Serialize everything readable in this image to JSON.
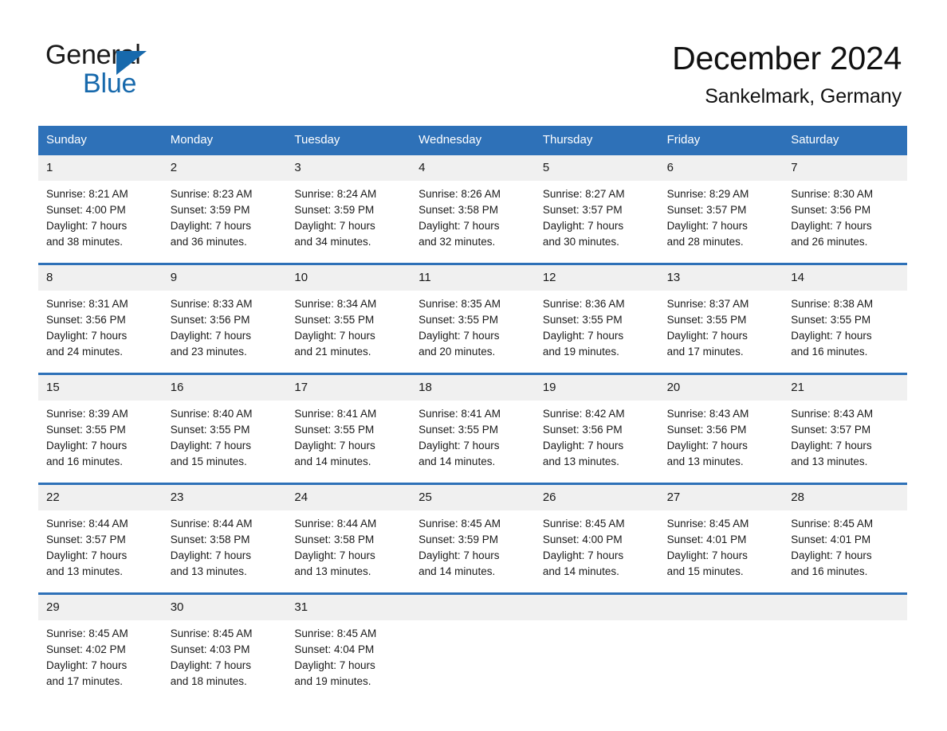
{
  "brand": {
    "name_part1": "General",
    "name_part2": "Blue"
  },
  "header": {
    "title": "December 2024",
    "subtitle": "Sankelmark, Germany"
  },
  "colors": {
    "header_blue": "#2e71b8",
    "brand_blue": "#1769ac",
    "daynum_background": "#f0f0f0",
    "text": "#1a1a1a"
  },
  "weekdays": [
    "Sunday",
    "Monday",
    "Tuesday",
    "Wednesday",
    "Thursday",
    "Friday",
    "Saturday"
  ],
  "labels": {
    "sunrise_prefix": "Sunrise:",
    "sunset_prefix": "Sunset:",
    "daylight_prefix": "Daylight:"
  },
  "weeks": [
    [
      {
        "day": "1",
        "sunrise": "Sunrise: 8:21 AM",
        "sunset": "Sunset: 4:00 PM",
        "daylight_line1": "Daylight: 7 hours",
        "daylight_line2": "and 38 minutes."
      },
      {
        "day": "2",
        "sunrise": "Sunrise: 8:23 AM",
        "sunset": "Sunset: 3:59 PM",
        "daylight_line1": "Daylight: 7 hours",
        "daylight_line2": "and 36 minutes."
      },
      {
        "day": "3",
        "sunrise": "Sunrise: 8:24 AM",
        "sunset": "Sunset: 3:59 PM",
        "daylight_line1": "Daylight: 7 hours",
        "daylight_line2": "and 34 minutes."
      },
      {
        "day": "4",
        "sunrise": "Sunrise: 8:26 AM",
        "sunset": "Sunset: 3:58 PM",
        "daylight_line1": "Daylight: 7 hours",
        "daylight_line2": "and 32 minutes."
      },
      {
        "day": "5",
        "sunrise": "Sunrise: 8:27 AM",
        "sunset": "Sunset: 3:57 PM",
        "daylight_line1": "Daylight: 7 hours",
        "daylight_line2": "and 30 minutes."
      },
      {
        "day": "6",
        "sunrise": "Sunrise: 8:29 AM",
        "sunset": "Sunset: 3:57 PM",
        "daylight_line1": "Daylight: 7 hours",
        "daylight_line2": "and 28 minutes."
      },
      {
        "day": "7",
        "sunrise": "Sunrise: 8:30 AM",
        "sunset": "Sunset: 3:56 PM",
        "daylight_line1": "Daylight: 7 hours",
        "daylight_line2": "and 26 minutes."
      }
    ],
    [
      {
        "day": "8",
        "sunrise": "Sunrise: 8:31 AM",
        "sunset": "Sunset: 3:56 PM",
        "daylight_line1": "Daylight: 7 hours",
        "daylight_line2": "and 24 minutes."
      },
      {
        "day": "9",
        "sunrise": "Sunrise: 8:33 AM",
        "sunset": "Sunset: 3:56 PM",
        "daylight_line1": "Daylight: 7 hours",
        "daylight_line2": "and 23 minutes."
      },
      {
        "day": "10",
        "sunrise": "Sunrise: 8:34 AM",
        "sunset": "Sunset: 3:55 PM",
        "daylight_line1": "Daylight: 7 hours",
        "daylight_line2": "and 21 minutes."
      },
      {
        "day": "11",
        "sunrise": "Sunrise: 8:35 AM",
        "sunset": "Sunset: 3:55 PM",
        "daylight_line1": "Daylight: 7 hours",
        "daylight_line2": "and 20 minutes."
      },
      {
        "day": "12",
        "sunrise": "Sunrise: 8:36 AM",
        "sunset": "Sunset: 3:55 PM",
        "daylight_line1": "Daylight: 7 hours",
        "daylight_line2": "and 19 minutes."
      },
      {
        "day": "13",
        "sunrise": "Sunrise: 8:37 AM",
        "sunset": "Sunset: 3:55 PM",
        "daylight_line1": "Daylight: 7 hours",
        "daylight_line2": "and 17 minutes."
      },
      {
        "day": "14",
        "sunrise": "Sunrise: 8:38 AM",
        "sunset": "Sunset: 3:55 PM",
        "daylight_line1": "Daylight: 7 hours",
        "daylight_line2": "and 16 minutes."
      }
    ],
    [
      {
        "day": "15",
        "sunrise": "Sunrise: 8:39 AM",
        "sunset": "Sunset: 3:55 PM",
        "daylight_line1": "Daylight: 7 hours",
        "daylight_line2": "and 16 minutes."
      },
      {
        "day": "16",
        "sunrise": "Sunrise: 8:40 AM",
        "sunset": "Sunset: 3:55 PM",
        "daylight_line1": "Daylight: 7 hours",
        "daylight_line2": "and 15 minutes."
      },
      {
        "day": "17",
        "sunrise": "Sunrise: 8:41 AM",
        "sunset": "Sunset: 3:55 PM",
        "daylight_line1": "Daylight: 7 hours",
        "daylight_line2": "and 14 minutes."
      },
      {
        "day": "18",
        "sunrise": "Sunrise: 8:41 AM",
        "sunset": "Sunset: 3:55 PM",
        "daylight_line1": "Daylight: 7 hours",
        "daylight_line2": "and 14 minutes."
      },
      {
        "day": "19",
        "sunrise": "Sunrise: 8:42 AM",
        "sunset": "Sunset: 3:56 PM",
        "daylight_line1": "Daylight: 7 hours",
        "daylight_line2": "and 13 minutes."
      },
      {
        "day": "20",
        "sunrise": "Sunrise: 8:43 AM",
        "sunset": "Sunset: 3:56 PM",
        "daylight_line1": "Daylight: 7 hours",
        "daylight_line2": "and 13 minutes."
      },
      {
        "day": "21",
        "sunrise": "Sunrise: 8:43 AM",
        "sunset": "Sunset: 3:57 PM",
        "daylight_line1": "Daylight: 7 hours",
        "daylight_line2": "and 13 minutes."
      }
    ],
    [
      {
        "day": "22",
        "sunrise": "Sunrise: 8:44 AM",
        "sunset": "Sunset: 3:57 PM",
        "daylight_line1": "Daylight: 7 hours",
        "daylight_line2": "and 13 minutes."
      },
      {
        "day": "23",
        "sunrise": "Sunrise: 8:44 AM",
        "sunset": "Sunset: 3:58 PM",
        "daylight_line1": "Daylight: 7 hours",
        "daylight_line2": "and 13 minutes."
      },
      {
        "day": "24",
        "sunrise": "Sunrise: 8:44 AM",
        "sunset": "Sunset: 3:58 PM",
        "daylight_line1": "Daylight: 7 hours",
        "daylight_line2": "and 13 minutes."
      },
      {
        "day": "25",
        "sunrise": "Sunrise: 8:45 AM",
        "sunset": "Sunset: 3:59 PM",
        "daylight_line1": "Daylight: 7 hours",
        "daylight_line2": "and 14 minutes."
      },
      {
        "day": "26",
        "sunrise": "Sunrise: 8:45 AM",
        "sunset": "Sunset: 4:00 PM",
        "daylight_line1": "Daylight: 7 hours",
        "daylight_line2": "and 14 minutes."
      },
      {
        "day": "27",
        "sunrise": "Sunrise: 8:45 AM",
        "sunset": "Sunset: 4:01 PM",
        "daylight_line1": "Daylight: 7 hours",
        "daylight_line2": "and 15 minutes."
      },
      {
        "day": "28",
        "sunrise": "Sunrise: 8:45 AM",
        "sunset": "Sunset: 4:01 PM",
        "daylight_line1": "Daylight: 7 hours",
        "daylight_line2": "and 16 minutes."
      }
    ],
    [
      {
        "day": "29",
        "sunrise": "Sunrise: 8:45 AM",
        "sunset": "Sunset: 4:02 PM",
        "daylight_line1": "Daylight: 7 hours",
        "daylight_line2": "and 17 minutes."
      },
      {
        "day": "30",
        "sunrise": "Sunrise: 8:45 AM",
        "sunset": "Sunset: 4:03 PM",
        "daylight_line1": "Daylight: 7 hours",
        "daylight_line2": "and 18 minutes."
      },
      {
        "day": "31",
        "sunrise": "Sunrise: 8:45 AM",
        "sunset": "Sunset: 4:04 PM",
        "daylight_line1": "Daylight: 7 hours",
        "daylight_line2": "and 19 minutes."
      },
      {
        "day": "",
        "sunrise": "",
        "sunset": "",
        "daylight_line1": "",
        "daylight_line2": ""
      },
      {
        "day": "",
        "sunrise": "",
        "sunset": "",
        "daylight_line1": "",
        "daylight_line2": ""
      },
      {
        "day": "",
        "sunrise": "",
        "sunset": "",
        "daylight_line1": "",
        "daylight_line2": ""
      },
      {
        "day": "",
        "sunrise": "",
        "sunset": "",
        "daylight_line1": "",
        "daylight_line2": ""
      }
    ]
  ]
}
